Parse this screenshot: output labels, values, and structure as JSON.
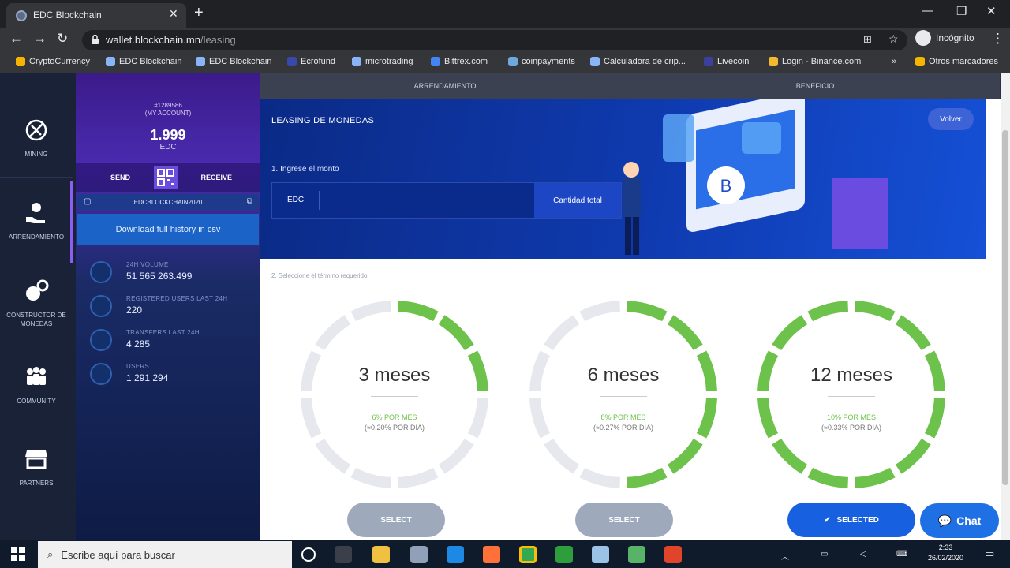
{
  "browser": {
    "tab_title": "EDC Blockchain",
    "url_host": "wallet.blockchain.mn",
    "url_path": "/leasing",
    "profile_label": "Incógnito",
    "bookmarks": [
      "CryptoCurrency",
      "EDC Blockchain",
      "EDC Blockchain",
      "Ecrofund",
      "microtrading",
      "Bittrex.com",
      "coinpayments",
      "Calculadora de crip...",
      "Livecoin",
      "Login - Binance.com",
      "Otros marcadores"
    ]
  },
  "nav": {
    "items": [
      {
        "label": "MINING",
        "icon": "mining-icon"
      },
      {
        "label": "ARRENDAMIENTO",
        "icon": "leasing-icon"
      },
      {
        "label": "CONSTRUCTOR DE MONEDAS",
        "icon": "coin-builder-icon"
      },
      {
        "label": "COMMUNITY",
        "icon": "community-icon"
      },
      {
        "label": "PARTNERS",
        "icon": "partners-icon"
      }
    ]
  },
  "account": {
    "id": "#1289586",
    "subtitle": "(MY ACCOUNT)",
    "balance": "1.999",
    "currency": "EDC",
    "send": "SEND",
    "receive": "RECEIVE",
    "address": "EDCBLOCKCHAIN2020",
    "download": "Download full history in csv",
    "stats": [
      {
        "label": "24H VOLUME",
        "value": "51 565 263.499"
      },
      {
        "label": "REGISTERED USERS LAST 24H",
        "value": "220"
      },
      {
        "label": "TRANSFERS LAST 24H",
        "value": "4 285"
      },
      {
        "label": "USERS",
        "value": "1 291 294"
      }
    ]
  },
  "tabs": [
    "ARRENDAMIENTO",
    "BENEFICIO"
  ],
  "leasing": {
    "title": "LEASING DE MONEDAS",
    "back": "Volver",
    "step1": "1. Ingrese el monto",
    "currency": "EDC",
    "amount_value": "",
    "total_button": "Cantidad total",
    "step2": "2. Seleccione el término requerido",
    "plans": [
      {
        "title": "3 meses",
        "rate": "6% POR MES",
        "daily": "(≈0.20% POR DÍA)",
        "fill": 0.25,
        "button": "SELECT",
        "selected": false
      },
      {
        "title": "6 meses",
        "rate": "8% POR MES",
        "daily": "(≈0.27% POR DÍA)",
        "fill": 0.5,
        "button": "SELECT",
        "selected": false
      },
      {
        "title": "12 meses",
        "rate": "10% POR MES",
        "daily": "(≈0.33% POR DÍA)",
        "fill": 1.0,
        "button": "SELECTED",
        "selected": true
      }
    ],
    "chat": "Chat"
  },
  "colors": {
    "green": "#6cc24a",
    "ring_bg": "#e6e8ee",
    "accent": "#1760e0"
  },
  "taskbar": {
    "search_placeholder": "Escribe aquí para buscar",
    "time": "2:33",
    "date": "26/02/2020"
  }
}
